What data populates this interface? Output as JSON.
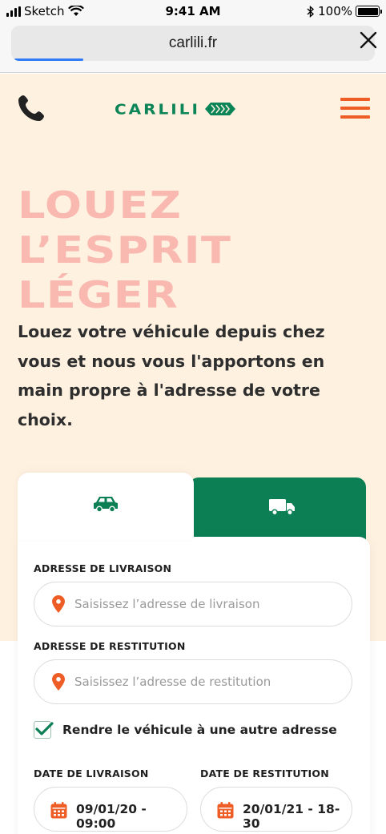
{
  "status_bar": {
    "carrier": "Sketch",
    "time": "9:41 AM",
    "battery": "100%"
  },
  "browser": {
    "url": "carlili.fr",
    "load_progress": 0.19
  },
  "header": {
    "logo_text": "CARLILI",
    "brand_color": "#0b8457",
    "menu_color": "#ef5d27"
  },
  "hero": {
    "headline": [
      "LOUEZ",
      "L’ESPRIT",
      "LÉGER"
    ],
    "description": "Louez votre véhicule depuis chez vous et nous vous l'apportons en main propre à l'adresse de votre choix.",
    "headline_color": "#f9b9b1",
    "background": "#fef1e0"
  },
  "booking_form": {
    "tabs": [
      {
        "icon": "car-icon",
        "active": true
      },
      {
        "icon": "truck-icon",
        "active": false
      }
    ],
    "delivery_label": "ADRESSE DE LIVRAISON",
    "delivery_placeholder": "Saisissez l’adresse de livraison",
    "return_label": "ADRESSE DE RESTITUTION",
    "return_placeholder": "Saisissez l’adresse de restitution",
    "other_address_checked": true,
    "other_address_label": "Rendre le véhicule à une autre adresse",
    "delivery_date_label": "DATE DE LIVRAISON",
    "delivery_date_value": "09/01/20 - 09:00",
    "return_date_label": "DATE DE RESTITUTION",
    "return_date_value": "20/01/21 - 18-30"
  }
}
